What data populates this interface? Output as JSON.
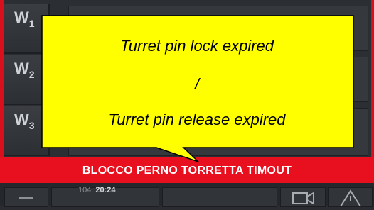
{
  "side_keys": [
    {
      "letter": "W",
      "number": "1"
    },
    {
      "letter": "W",
      "number": "2"
    },
    {
      "letter": "W",
      "number": "3"
    }
  ],
  "alarm": {
    "message": "BLOCCO PERNO TORRETTA TIMOUT"
  },
  "status": {
    "left_code": "104",
    "time": "20:24"
  },
  "callout": {
    "line1": "Turret pin lock expired",
    "separator": "/",
    "line2": "Turret pin release expired"
  },
  "colors": {
    "alarm_red": "#e8101f",
    "callout_fill": "#ffff00",
    "screen_bg": "#2b2e33"
  },
  "icons": [
    "video-camera-icon",
    "warning-triangle-icon",
    "menu-icon"
  ]
}
